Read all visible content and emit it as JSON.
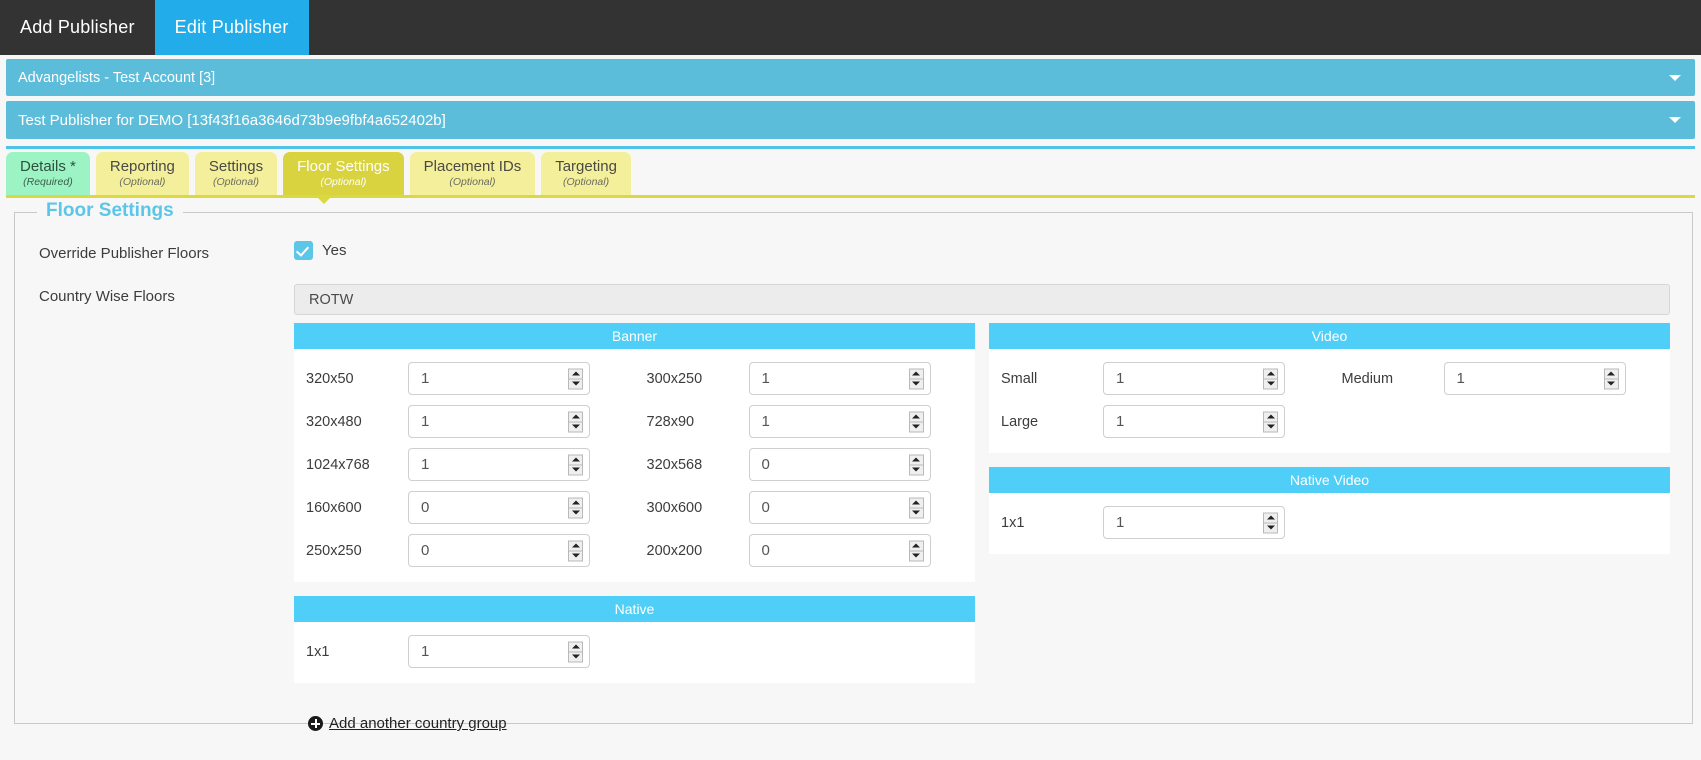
{
  "topnav": {
    "tabs": [
      {
        "label": "Add Publisher",
        "active": false
      },
      {
        "label": "Edit Publisher",
        "active": true
      }
    ]
  },
  "accordions": [
    {
      "label": "Advangelists - Test Account [3]",
      "icon": "chevron-down-icon"
    },
    {
      "label": "Test Publisher for DEMO [13f43f16a3646d73b9e9fbf4a652402b]",
      "icon": "chevron-down-icon"
    }
  ],
  "tabs": [
    {
      "label": "Details *",
      "sub": "(Required)",
      "state": "required"
    },
    {
      "label": "Reporting",
      "sub": "(Optional)",
      "state": "optional"
    },
    {
      "label": "Settings",
      "sub": "(Optional)",
      "state": "optional"
    },
    {
      "label": "Floor Settings",
      "sub": "(Optional)",
      "state": "active"
    },
    {
      "label": "Placement IDs",
      "sub": "(Optional)",
      "state": "optional"
    },
    {
      "label": "Targeting",
      "sub": "(Optional)",
      "state": "optional"
    }
  ],
  "panel": {
    "legend": "Floor Settings",
    "override": {
      "label": "Override Publisher Floors",
      "checkbox_label": "Yes",
      "checked": true
    },
    "country_wise": {
      "label": "Country Wise Floors",
      "group_name": "ROTW"
    },
    "sections": {
      "banner": {
        "title": "Banner",
        "fields": [
          {
            "label": "320x50",
            "value": "1"
          },
          {
            "label": "300x250",
            "value": "1"
          },
          {
            "label": "320x480",
            "value": "1"
          },
          {
            "label": "728x90",
            "value": "1"
          },
          {
            "label": "1024x768",
            "value": "1"
          },
          {
            "label": "320x568",
            "value": "0"
          },
          {
            "label": "160x600",
            "value": "0"
          },
          {
            "label": "300x600",
            "value": "0"
          },
          {
            "label": "250x250",
            "value": "0"
          },
          {
            "label": "200x200",
            "value": "0"
          }
        ]
      },
      "video": {
        "title": "Video",
        "fields": [
          {
            "label": "Small",
            "value": "1"
          },
          {
            "label": "Medium",
            "value": "1"
          },
          {
            "label": "Large",
            "value": "1"
          }
        ]
      },
      "native": {
        "title": "Native",
        "fields": [
          {
            "label": "1x1",
            "value": "1"
          }
        ]
      },
      "native_video": {
        "title": "Native Video",
        "fields": [
          {
            "label": "1x1",
            "value": "1"
          }
        ]
      }
    },
    "add_group_link": {
      "label": "Add another country group",
      "icon": "plus-circle-icon"
    }
  },
  "colors": {
    "topnav_bg": "#333333",
    "topnav_active": "#22ADEA",
    "accordion": "#5CBDDB",
    "section_header": "#4FCFF7",
    "tab_optional": "#F4EF9A",
    "tab_required": "#9CF3C4",
    "tab_active": "#D9D340",
    "legend_text": "#5BC6E8"
  }
}
